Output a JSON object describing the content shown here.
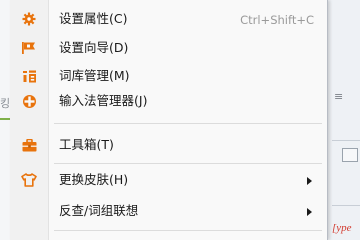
{
  "menu": {
    "items": [
      {
        "label": "设置属性(C)",
        "shortcut": "Ctrl+Shift+C",
        "icon": "gear-icon"
      },
      {
        "label": "设置向导(D)",
        "icon": "flag-icon"
      },
      {
        "label": "词库管理(M)",
        "icon": "dictionary-icon"
      },
      {
        "label": "输入法管理器(J)",
        "icon": "ime-manager-icon"
      },
      {
        "label": "工具箱(T)",
        "icon": "toolbox-icon"
      },
      {
        "label": "更换皮肤(H)",
        "icon": "shirt-icon",
        "submenu": true
      },
      {
        "label": "反查/词组联想",
        "submenu": true
      }
    ]
  },
  "background": {
    "right_fragment": "[ype"
  },
  "colors": {
    "icon_orange": "#e8730c",
    "menu_bg": "#f9f9f9",
    "gutter_bg": "#f1f1f1",
    "separator": "#dcdcdc"
  }
}
